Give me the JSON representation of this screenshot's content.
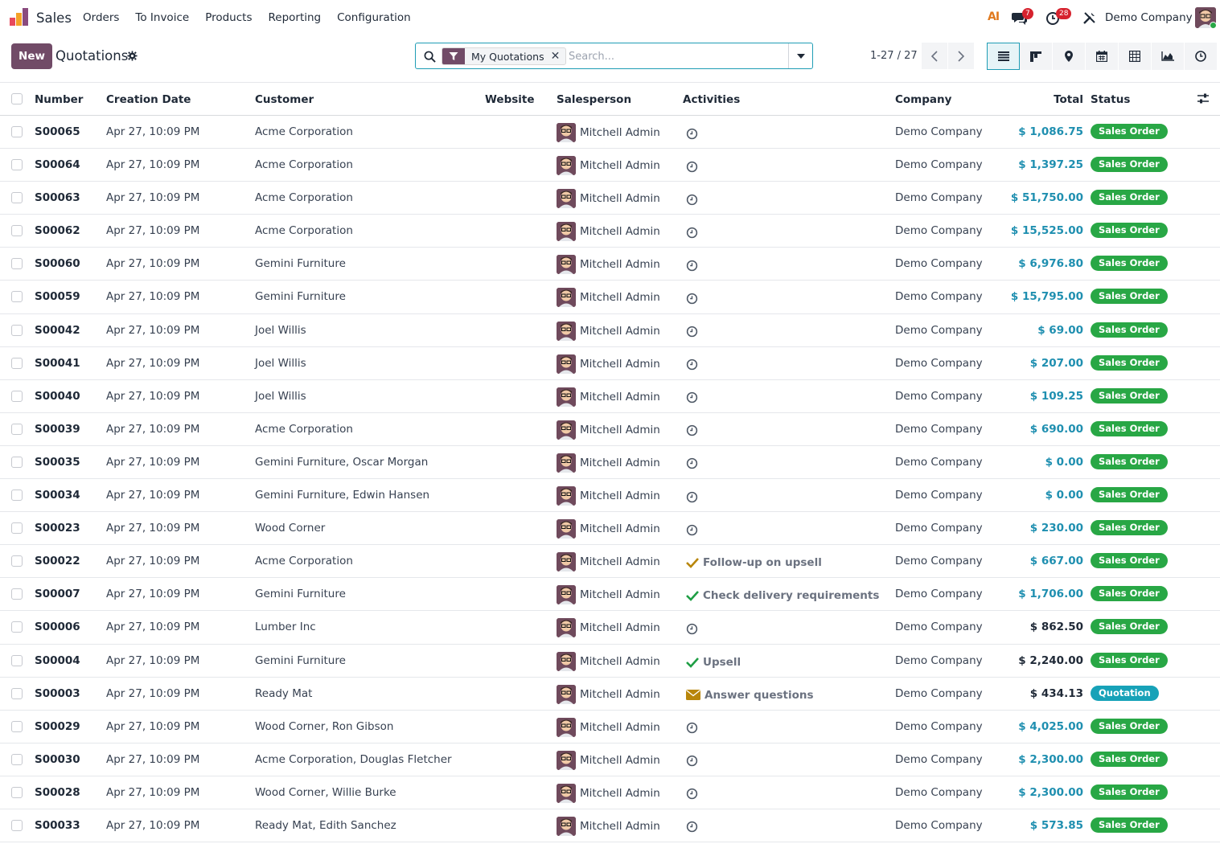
{
  "navbar": {
    "app_name": "Sales",
    "menu": [
      "Orders",
      "To Invoice",
      "Products",
      "Reporting",
      "Configuration"
    ],
    "ai_label": "AI",
    "messages_badge": "7",
    "activities_badge": "28",
    "company": "Demo Company"
  },
  "control": {
    "new_label": "New",
    "title": "Quotations",
    "facet_label": "My Quotations",
    "search_placeholder": "Search...",
    "pager": "1-27 / 27"
  },
  "colors": {
    "brand": "#714b67",
    "accent": "#1f9db5",
    "sales_order": "#28a745",
    "quotation": "#17a2b8",
    "total_link": "#1f8fb0"
  },
  "table": {
    "headers": {
      "number": "Number",
      "date": "Creation Date",
      "customer": "Customer",
      "website": "Website",
      "salesperson": "Salesperson",
      "activities": "Activities",
      "company": "Company",
      "total": "Total",
      "status": "Status"
    },
    "rows": [
      {
        "number": "S00065",
        "date": "Apr 27, 10:09 PM",
        "customer": "Acme Corporation",
        "salesperson": "Mitchell Admin",
        "activity": "",
        "activity_icon": "clock",
        "company": "Demo Company",
        "total": "$ 1,086.75",
        "total_style": "link",
        "status": "Sales Order"
      },
      {
        "number": "S00064",
        "date": "Apr 27, 10:09 PM",
        "customer": "Acme Corporation",
        "salesperson": "Mitchell Admin",
        "activity": "",
        "activity_icon": "clock",
        "company": "Demo Company",
        "total": "$ 1,397.25",
        "total_style": "link",
        "status": "Sales Order"
      },
      {
        "number": "S00063",
        "date": "Apr 27, 10:09 PM",
        "customer": "Acme Corporation",
        "salesperson": "Mitchell Admin",
        "activity": "",
        "activity_icon": "clock",
        "company": "Demo Company",
        "total": "$ 51,750.00",
        "total_style": "link",
        "status": "Sales Order"
      },
      {
        "number": "S00062",
        "date": "Apr 27, 10:09 PM",
        "customer": "Acme Corporation",
        "salesperson": "Mitchell Admin",
        "activity": "",
        "activity_icon": "clock",
        "company": "Demo Company",
        "total": "$ 15,525.00",
        "total_style": "link",
        "status": "Sales Order"
      },
      {
        "number": "S00060",
        "date": "Apr 27, 10:09 PM",
        "customer": "Gemini Furniture",
        "salesperson": "Mitchell Admin",
        "activity": "",
        "activity_icon": "clock",
        "company": "Demo Company",
        "total": "$ 6,976.80",
        "total_style": "link",
        "status": "Sales Order"
      },
      {
        "number": "S00059",
        "date": "Apr 27, 10:09 PM",
        "customer": "Gemini Furniture",
        "salesperson": "Mitchell Admin",
        "activity": "",
        "activity_icon": "clock",
        "company": "Demo Company",
        "total": "$ 15,795.00",
        "total_style": "link",
        "status": "Sales Order"
      },
      {
        "number": "S00042",
        "date": "Apr 27, 10:09 PM",
        "customer": "Joel Willis",
        "salesperson": "Mitchell Admin",
        "activity": "",
        "activity_icon": "clock",
        "company": "Demo Company",
        "total": "$ 69.00",
        "total_style": "link",
        "status": "Sales Order"
      },
      {
        "number": "S00041",
        "date": "Apr 27, 10:09 PM",
        "customer": "Joel Willis",
        "salesperson": "Mitchell Admin",
        "activity": "",
        "activity_icon": "clock",
        "company": "Demo Company",
        "total": "$ 207.00",
        "total_style": "link",
        "status": "Sales Order"
      },
      {
        "number": "S00040",
        "date": "Apr 27, 10:09 PM",
        "customer": "Joel Willis",
        "salesperson": "Mitchell Admin",
        "activity": "",
        "activity_icon": "clock",
        "company": "Demo Company",
        "total": "$ 109.25",
        "total_style": "link",
        "status": "Sales Order"
      },
      {
        "number": "S00039",
        "date": "Apr 27, 10:09 PM",
        "customer": "Acme Corporation",
        "salesperson": "Mitchell Admin",
        "activity": "",
        "activity_icon": "clock",
        "company": "Demo Company",
        "total": "$ 690.00",
        "total_style": "link",
        "status": "Sales Order"
      },
      {
        "number": "S00035",
        "date": "Apr 27, 10:09 PM",
        "customer": "Gemini Furniture, Oscar Morgan",
        "salesperson": "Mitchell Admin",
        "activity": "",
        "activity_icon": "clock",
        "company": "Demo Company",
        "total": "$ 0.00",
        "total_style": "link",
        "status": "Sales Order"
      },
      {
        "number": "S00034",
        "date": "Apr 27, 10:09 PM",
        "customer": "Gemini Furniture, Edwin Hansen",
        "salesperson": "Mitchell Admin",
        "activity": "",
        "activity_icon": "clock",
        "company": "Demo Company",
        "total": "$ 0.00",
        "total_style": "link",
        "status": "Sales Order"
      },
      {
        "number": "S00023",
        "date": "Apr 27, 10:09 PM",
        "customer": "Wood Corner",
        "salesperson": "Mitchell Admin",
        "activity": "",
        "activity_icon": "clock",
        "company": "Demo Company",
        "total": "$ 230.00",
        "total_style": "link",
        "status": "Sales Order"
      },
      {
        "number": "S00022",
        "date": "Apr 27, 10:09 PM",
        "customer": "Acme Corporation",
        "salesperson": "Mitchell Admin",
        "activity": "Follow-up on upsell",
        "activity_icon": "check-warning",
        "company": "Demo Company",
        "total": "$ 667.00",
        "total_style": "link",
        "status": "Sales Order"
      },
      {
        "number": "S00007",
        "date": "Apr 27, 10:09 PM",
        "customer": "Gemini Furniture",
        "salesperson": "Mitchell Admin",
        "activity": "Check delivery requirements",
        "activity_icon": "check-success",
        "company": "Demo Company",
        "total": "$ 1,706.00",
        "total_style": "link",
        "status": "Sales Order"
      },
      {
        "number": "S00006",
        "date": "Apr 27, 10:09 PM",
        "customer": "Lumber Inc",
        "salesperson": "Mitchell Admin",
        "activity": "",
        "activity_icon": "clock",
        "company": "Demo Company",
        "total": "$ 862.50",
        "total_style": "plain",
        "status": "Sales Order"
      },
      {
        "number": "S00004",
        "date": "Apr 27, 10:09 PM",
        "customer": "Gemini Furniture",
        "salesperson": "Mitchell Admin",
        "activity": "Upsell",
        "activity_icon": "check-success",
        "company": "Demo Company",
        "total": "$ 2,240.00",
        "total_style": "plain",
        "status": "Sales Order"
      },
      {
        "number": "S00003",
        "date": "Apr 27, 10:09 PM",
        "customer": "Ready Mat",
        "salesperson": "Mitchell Admin",
        "activity": "Answer questions",
        "activity_icon": "envelope",
        "company": "Demo Company",
        "total": "$ 434.13",
        "total_style": "plain",
        "status": "Quotation"
      },
      {
        "number": "S00029",
        "date": "Apr 27, 10:09 PM",
        "customer": "Wood Corner, Ron Gibson",
        "salesperson": "Mitchell Admin",
        "activity": "",
        "activity_icon": "clock",
        "company": "Demo Company",
        "total": "$ 4,025.00",
        "total_style": "link",
        "status": "Sales Order"
      },
      {
        "number": "S00030",
        "date": "Apr 27, 10:09 PM",
        "customer": "Acme Corporation, Douglas Fletcher",
        "salesperson": "Mitchell Admin",
        "activity": "",
        "activity_icon": "clock",
        "company": "Demo Company",
        "total": "$ 2,300.00",
        "total_style": "link",
        "status": "Sales Order"
      },
      {
        "number": "S00028",
        "date": "Apr 27, 10:09 PM",
        "customer": "Wood Corner, Willie Burke",
        "salesperson": "Mitchell Admin",
        "activity": "",
        "activity_icon": "clock",
        "company": "Demo Company",
        "total": "$ 2,300.00",
        "total_style": "link",
        "status": "Sales Order"
      },
      {
        "number": "S00033",
        "date": "Apr 27, 10:09 PM",
        "customer": "Ready Mat, Edith Sanchez",
        "salesperson": "Mitchell Admin",
        "activity": "",
        "activity_icon": "clock",
        "company": "Demo Company",
        "total": "$ 573.85",
        "total_style": "link",
        "status": "Sales Order"
      }
    ]
  }
}
